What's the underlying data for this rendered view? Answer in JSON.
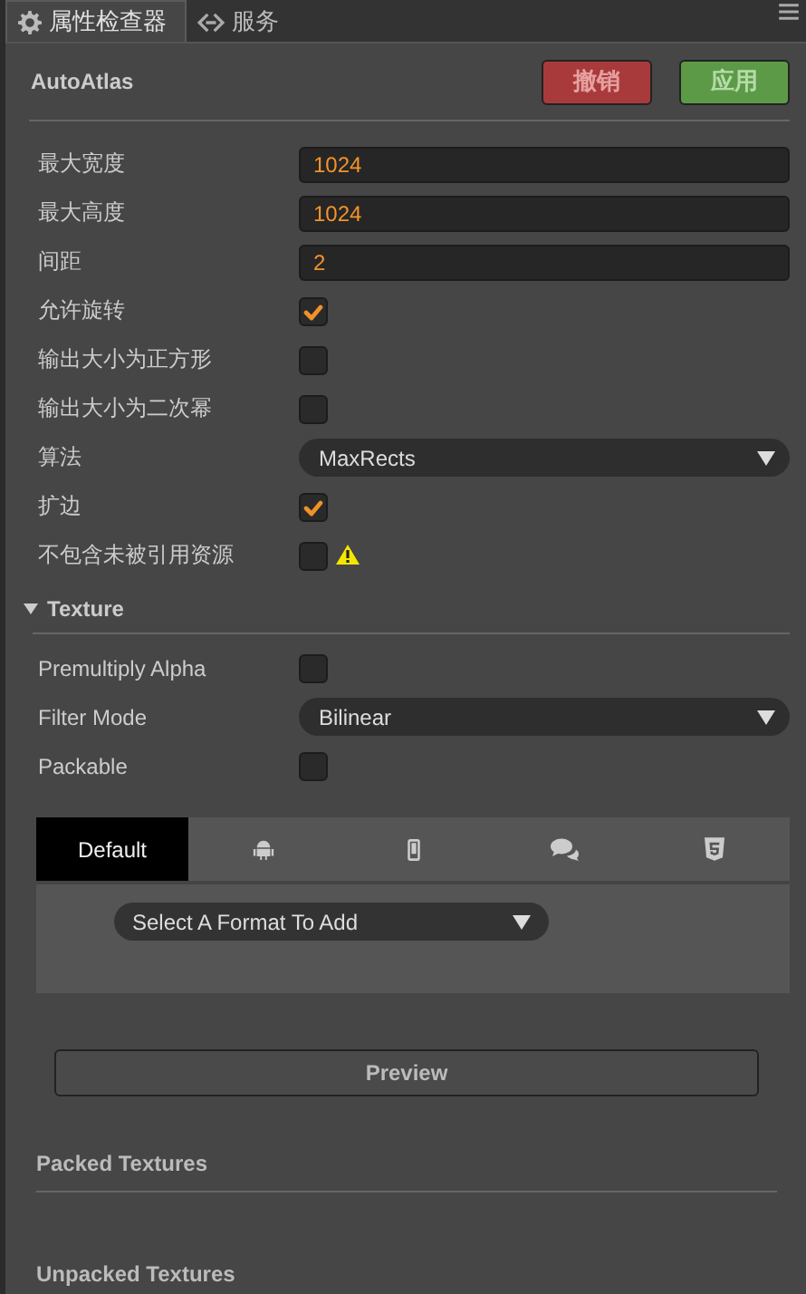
{
  "tabs": [
    {
      "kind": "gear",
      "label": "属性检查器",
      "selected": true
    },
    {
      "kind": "link",
      "label": "服务",
      "selected": false
    }
  ],
  "header": {
    "title": "AutoAtlas",
    "buttons": [
      {
        "kind": "revert",
        "label": "撤销",
        "disabled": true
      },
      {
        "kind": "apply",
        "label": "应用",
        "disabled": true
      }
    ]
  },
  "properties": [
    {
      "kind": "number",
      "label": "最大宽度",
      "value": "1024"
    },
    {
      "kind": "number",
      "label": "最大高度",
      "value": "1024"
    },
    {
      "kind": "number",
      "label": "间距",
      "value": "2"
    },
    {
      "kind": "checkbox",
      "label": "允许旋转",
      "checked": true
    },
    {
      "kind": "checkbox",
      "label": "输出大小为正方形",
      "checked": false
    },
    {
      "kind": "checkbox",
      "label": "输出大小为二次幂",
      "checked": false
    },
    {
      "kind": "select",
      "label": "算法",
      "value": "MaxRects"
    },
    {
      "kind": "checkbox",
      "label": "扩边",
      "checked": true
    },
    {
      "kind": "checkbox",
      "label": "不包含未被引用资源",
      "checked": false,
      "warning": true
    }
  ],
  "texture": {
    "title": "Texture",
    "expanded": true,
    "properties": [
      {
        "kind": "checkbox",
        "label": "Premultiply Alpha",
        "checked": false
      },
      {
        "kind": "select",
        "label": "Filter Mode",
        "value": "Bilinear"
      },
      {
        "kind": "checkbox",
        "label": "Packable",
        "checked": false
      }
    ]
  },
  "platform_tabs": [
    {
      "kind": "text",
      "label": "Default",
      "selected": true
    },
    {
      "kind": "android",
      "selected": false
    },
    {
      "kind": "phone",
      "selected": false
    },
    {
      "kind": "chat",
      "selected": false
    },
    {
      "kind": "html5",
      "selected": false
    }
  ],
  "format_select": {
    "value": "Select A Format To Add"
  },
  "preview_button": "Preview",
  "packed_textures": {
    "title": "Packed Textures"
  },
  "unpacked_textures": {
    "title": "Unpacked Textures"
  }
}
